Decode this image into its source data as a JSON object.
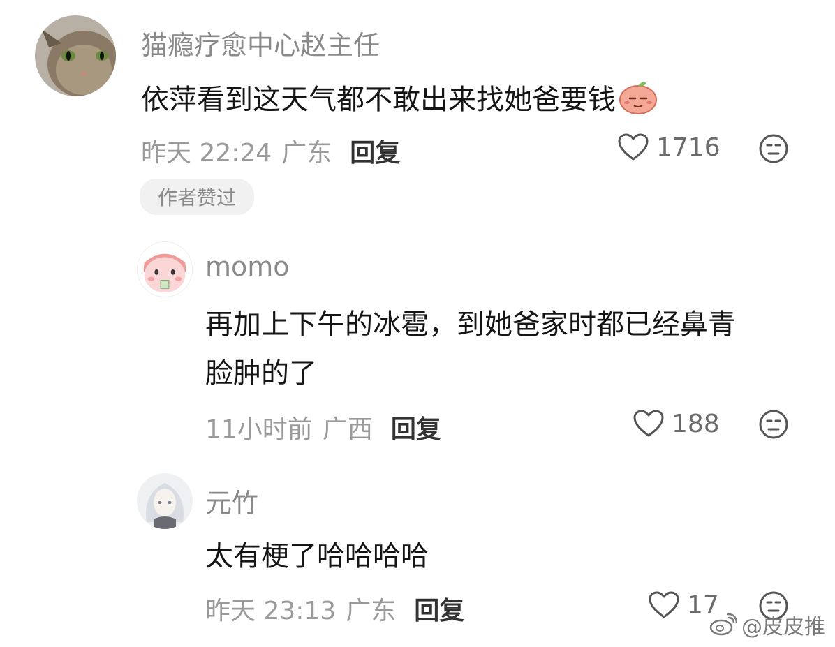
{
  "comments": [
    {
      "username": "猫瘾疗愈中心赵主任",
      "text": "依萍看到这天气都不敢出来找她爸要钱",
      "time": "昨天 22:24",
      "location": "广东",
      "reply_label": "回复",
      "likes": "1716",
      "badge": "作者赞过",
      "emoji_icon": "peach-face-emoji-icon"
    },
    {
      "username": "momo",
      "text_line1": "再加上下午的冰雹，到她爸家时都已经鼻青",
      "text_line2": "脸肿的了",
      "time": "11小时前",
      "location": "广西",
      "reply_label": "回复",
      "likes": "188"
    },
    {
      "username": "元竹",
      "text": "太有梗了哈哈哈哈",
      "time": "昨天 23:13",
      "location": "广东",
      "reply_label": "回复",
      "likes": "17"
    }
  ],
  "watermark": {
    "text": "@皮皮推",
    "icon": "weibo-logo-icon"
  },
  "colors": {
    "username": "#8a8a8a",
    "meta": "#9a9a9a",
    "badge_bg": "#f1f1f1"
  }
}
